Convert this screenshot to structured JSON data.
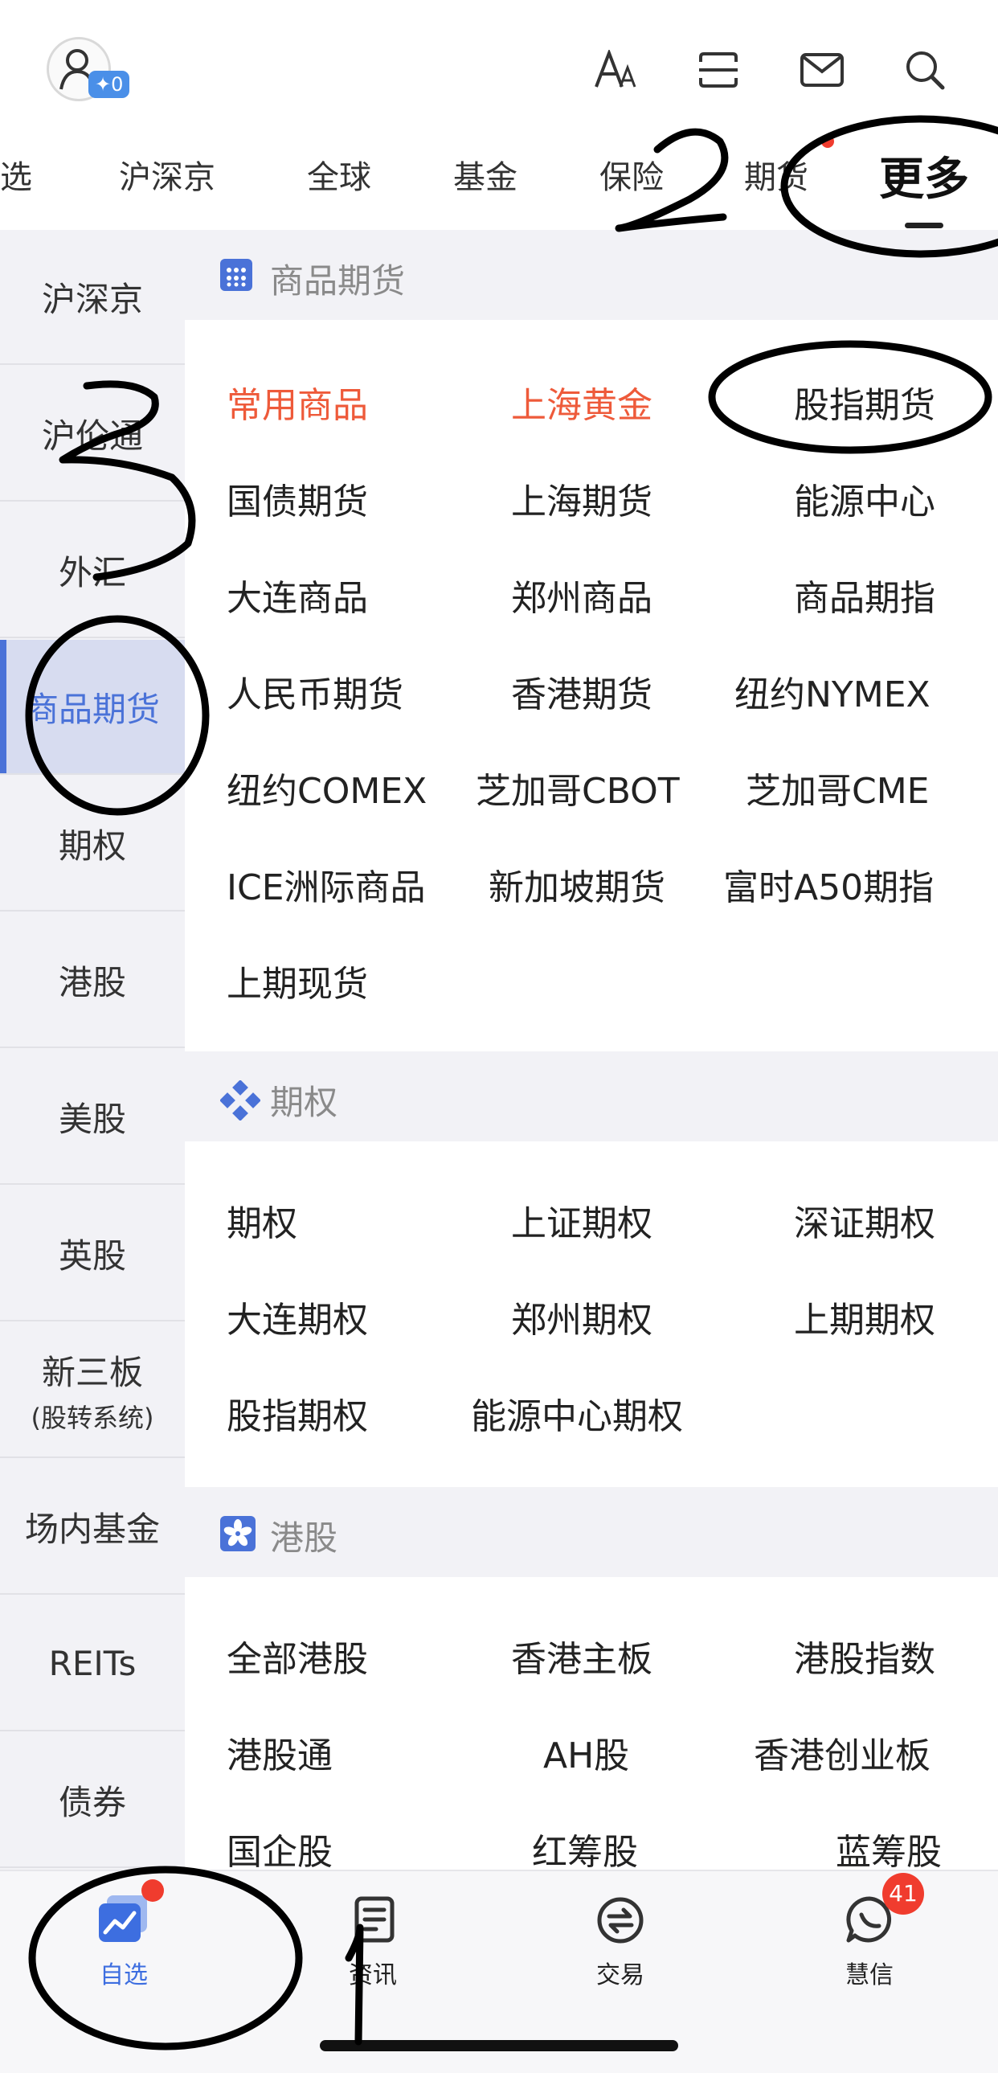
{
  "header": {
    "points_badge": "✦0",
    "icons": [
      "user-avatar-icon",
      "font-size-icon",
      "scan-icon",
      "mail-icon",
      "search-icon"
    ]
  },
  "tabs": [
    "选",
    "沪深京",
    "全球",
    "基金",
    "保险",
    "期货",
    "更多"
  ],
  "sidebar": {
    "items": [
      {
        "label": "沪深京"
      },
      {
        "label": "沪伦通"
      },
      {
        "label": "外汇"
      },
      {
        "label": "商品期货",
        "active": true
      },
      {
        "label": "期权"
      },
      {
        "label": "港股"
      },
      {
        "label": "美股"
      },
      {
        "label": "英股"
      },
      {
        "label": "新三板",
        "sub": "(股转系统)"
      },
      {
        "label": "场内基金"
      },
      {
        "label": "REITs"
      },
      {
        "label": "债券"
      }
    ]
  },
  "sections": [
    {
      "title": "商品期货",
      "icon": "grid-icon",
      "items": [
        [
          "常用商品",
          "上海黄金",
          "股指期货"
        ],
        [
          "国债期货",
          "上海期货",
          "能源中心"
        ],
        [
          "大连商品",
          "郑州商品",
          "商品期指"
        ],
        [
          "人民币期货",
          "香港期货",
          "纽约NYMEX"
        ],
        [
          "纽约COMEX",
          "芝加哥CBOT",
          "芝加哥CME"
        ],
        [
          "ICE洲际商品",
          "新加坡期货",
          "富时A50期指"
        ],
        [
          "上期现货"
        ]
      ],
      "highlighted": [
        "常用商品",
        "上海黄金"
      ]
    },
    {
      "title": "期权",
      "icon": "options-icon",
      "items": [
        [
          "期权",
          "上证期权",
          "深证期权"
        ],
        [
          "大连期权",
          "郑州期权",
          "上期期权"
        ],
        [
          "股指期权",
          "能源中心期权"
        ]
      ]
    },
    {
      "title": "港股",
      "icon": "hk-flower-icon",
      "items": [
        [
          "全部港股",
          "香港主板",
          "港股指数"
        ],
        [
          "港股通",
          "AH股",
          "香港创业板"
        ],
        [
          "国企股",
          "红筹股",
          "蓝筹股"
        ]
      ]
    }
  ],
  "bottom_nav": [
    {
      "label": "自选",
      "icon": "watchlist-chart-icon",
      "active": true
    },
    {
      "label": "资讯",
      "icon": "news-icon"
    },
    {
      "label": "交易",
      "icon": "trade-exchange-icon"
    },
    {
      "label": "慧信",
      "icon": "chat-bubble-icon",
      "badge": "41"
    }
  ],
  "annotations": [
    "1",
    "2",
    "3"
  ],
  "colors": {
    "accent": "#4a72d8",
    "hot": "#ee5a3a",
    "badge": "#f03c2e"
  }
}
